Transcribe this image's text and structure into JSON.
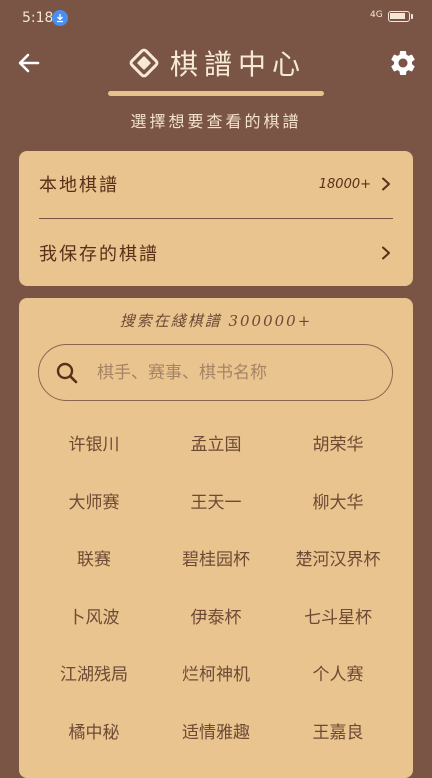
{
  "status": {
    "time": "5:18",
    "signal": "4G"
  },
  "header": {
    "title": "棋譜中心",
    "subtitle": "選擇想要查看的棋譜"
  },
  "local_card": {
    "local_label": "本地棋譜",
    "local_count": "18000+",
    "saved_label": "我保存的棋譜"
  },
  "online": {
    "title": "搜索在綫棋譜 300000+",
    "search_placeholder": "棋手、赛事、棋书名称",
    "tags": [
      "许银川",
      "孟立国",
      "胡荣华",
      "大师赛",
      "王天一",
      "柳大华",
      "联赛",
      "碧桂园杯",
      "楚河汉界杯",
      "卜风波",
      "伊泰杯",
      "七斗星杯",
      "江湖残局",
      "烂柯神机",
      "个人赛",
      "橘中秘",
      "适情雅趣",
      "王嘉良"
    ]
  },
  "colors": {
    "background": "#7a5445",
    "card": "#e9c48f",
    "accent": "#e6c28c",
    "text": "#5a2f18"
  },
  "icons": {
    "back": "back-arrow-icon",
    "settings": "gear-icon",
    "logo": "diamond-logo-icon",
    "chevron": "chevron-right-icon",
    "search": "search-icon",
    "download": "download-icon"
  }
}
